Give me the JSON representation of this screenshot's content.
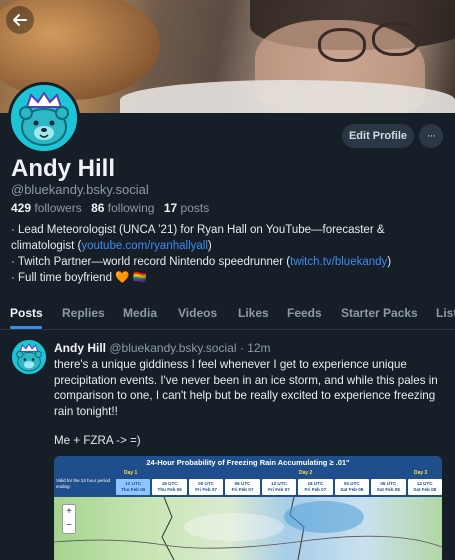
{
  "profile": {
    "name": "Andy Hill",
    "handle": "@bluekandy.bsky.social",
    "followers_count": "429",
    "followers_label": "followers",
    "following_count": "86",
    "following_label": "following",
    "posts_count": "17",
    "posts_label": "posts",
    "edit_label": "Edit Profile",
    "more_glyph": "···",
    "bio": {
      "line1_pre": "· Lead Meteorologist (UNCA ’21) for Ryan Hall on YouTube—forecaster &",
      "line2_pre": "climatologist (",
      "line2_link": "youtube.com/ryanhallyall",
      "line2_post": ")",
      "line3_pre": "· Twitch Partner—world record Nintendo speedrunner (",
      "line3_link": "twitch.tv/bluekandy",
      "line3_post": ")",
      "line4": "· Full time boyfriend 🧡 🏳️‍🌈"
    }
  },
  "tabs": [
    "Posts",
    "Replies",
    "Media",
    "Videos",
    "Likes",
    "Feeds",
    "Starter Packs",
    "Lists"
  ],
  "active_tab": "Posts",
  "post": {
    "author_name": "Andy Hill",
    "author_handle": "@bluekandy.bsky.social",
    "separator": "·",
    "time": "12m",
    "text": "there's a unique giddiness I feel whenever I get to experience unique precipitation events. I've never been in an ice storm, and while this pales in comparison to one, I can't help but be really excited to experience freezing rain tonight!!",
    "text2": "Me + FZRA -> =)",
    "image": {
      "title": "24-Hour Probability of Freezing Rain Accumulating ≥ .01\"",
      "left_label": "Valid for the 24 hour period ending:",
      "days": [
        "Day 1",
        "Day 2",
        "Day 3"
      ],
      "slots": [
        {
          "utc": "12 UTC",
          "date": "Thu Feb 06"
        },
        {
          "utc": "18 UTC",
          "date": "Thu Feb 06"
        },
        {
          "utc": "00 UTC",
          "date": "Fri Feb 07"
        },
        {
          "utc": "06 UTC",
          "date": "Fri Feb 07"
        },
        {
          "utc": "12 UTC",
          "date": "Fri Feb 07"
        },
        {
          "utc": "18 UTC",
          "date": "Fri Feb 07"
        },
        {
          "utc": "00 UTC",
          "date": "Sat Feb 08"
        },
        {
          "utc": "06 UTC",
          "date": "Sat Feb 08"
        },
        {
          "utc": "12 UTC",
          "date": "Sat Feb 08"
        }
      ],
      "zoom_in": "+",
      "zoom_out": "−"
    }
  },
  "colors": {
    "accent": "#3d8bf0",
    "background": "#161e27",
    "muted": "#8d9aa8",
    "avatar": "#1cc4d6"
  }
}
